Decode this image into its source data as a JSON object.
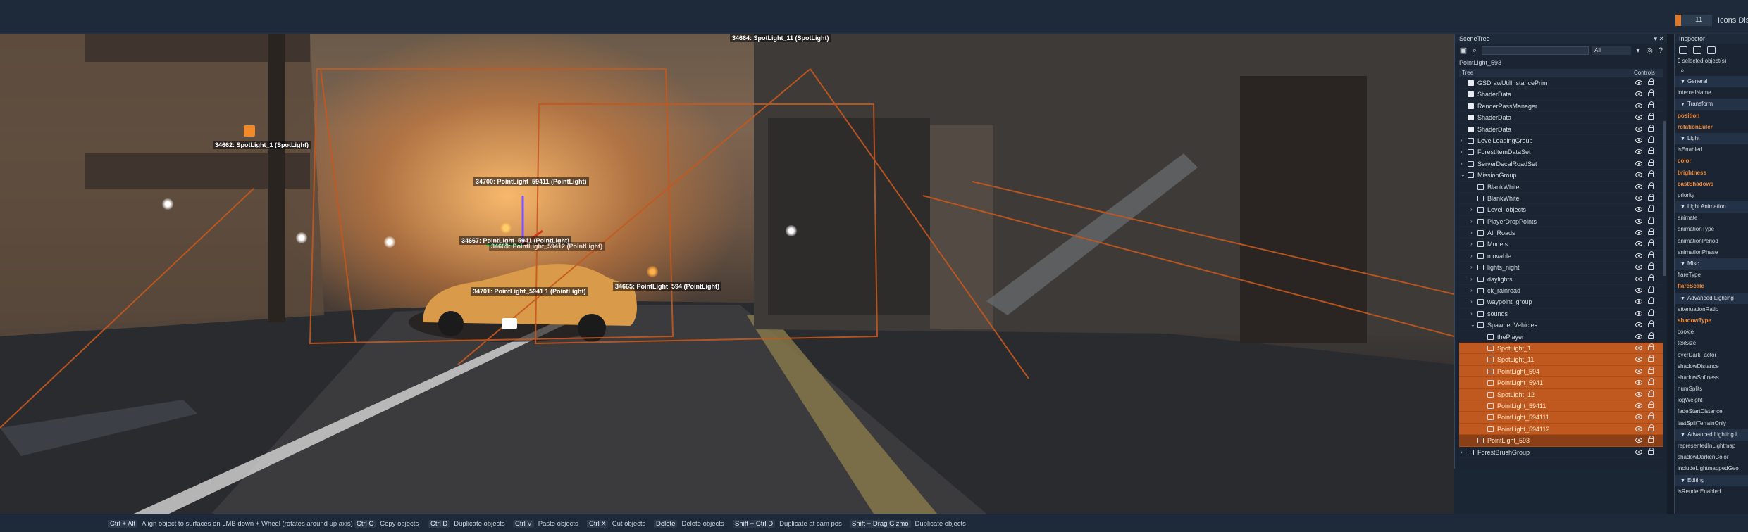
{
  "topbar": {
    "zoom_value": "11",
    "icons_label": "Icons Dista"
  },
  "viewport": {
    "labels": [
      "34664: SpotLight_11 (SpotLight)",
      "34662: SpotLight_1 (SpotLight)",
      "34700: PointLight_59411 (PointLight)",
      "34667: PointLight_5941 (PointLight)",
      "34669: PointLight_59412 (PointLight)",
      "34701: PointLight_5941 1 (PointLight)",
      "34665: PointLight_594 (PointLight)"
    ]
  },
  "scenetree": {
    "title": "SceneTree",
    "filter": "All",
    "path": "PointLight_593",
    "header_tree": "Tree",
    "header_controls": "Controls",
    "rows": [
      {
        "label": "GSDrawUtilInstancePrim",
        "indent": 0,
        "arrow": "",
        "icon": "fill",
        "sel": ""
      },
      {
        "label": "ShaderData",
        "indent": 0,
        "arrow": "",
        "icon": "fill",
        "sel": ""
      },
      {
        "label": "RenderPassManager",
        "indent": 0,
        "arrow": "",
        "icon": "fill",
        "sel": ""
      },
      {
        "label": "ShaderData",
        "indent": 0,
        "arrow": "",
        "icon": "fill",
        "sel": ""
      },
      {
        "label": "ShaderData",
        "indent": 0,
        "arrow": "",
        "icon": "fill",
        "sel": ""
      },
      {
        "label": "LevelLoadingGroup",
        "indent": 0,
        "arrow": "›",
        "icon": "folder",
        "sel": ""
      },
      {
        "label": "ForestItemDataSet",
        "indent": 0,
        "arrow": "›",
        "icon": "folder",
        "sel": ""
      },
      {
        "label": "ServerDecalRoadSet",
        "indent": 0,
        "arrow": "›",
        "icon": "folder",
        "sel": ""
      },
      {
        "label": "MissionGroup",
        "indent": 0,
        "arrow": "⌄",
        "icon": "folder",
        "sel": ""
      },
      {
        "label": "BlankWhite",
        "indent": 1,
        "arrow": "",
        "icon": "obj",
        "sel": ""
      },
      {
        "label": "BlankWhite",
        "indent": 1,
        "arrow": "",
        "icon": "obj",
        "sel": ""
      },
      {
        "label": "Level_objects",
        "indent": 1,
        "arrow": "›",
        "icon": "folder",
        "sel": ""
      },
      {
        "label": "PlayerDropPoints",
        "indent": 1,
        "arrow": "›",
        "icon": "folder",
        "sel": ""
      },
      {
        "label": "AI_Roads",
        "indent": 1,
        "arrow": "›",
        "icon": "folder",
        "sel": ""
      },
      {
        "label": "Models",
        "indent": 1,
        "arrow": "›",
        "icon": "folder",
        "sel": ""
      },
      {
        "label": "movable",
        "indent": 1,
        "arrow": "›",
        "icon": "folder",
        "sel": ""
      },
      {
        "label": "lights_night",
        "indent": 1,
        "arrow": "›",
        "icon": "folder",
        "sel": ""
      },
      {
        "label": "daylights",
        "indent": 1,
        "arrow": "›",
        "icon": "folder",
        "sel": ""
      },
      {
        "label": "ck_rainroad",
        "indent": 1,
        "arrow": "›",
        "icon": "folder",
        "sel": ""
      },
      {
        "label": "waypoint_group",
        "indent": 1,
        "arrow": "›",
        "icon": "folder",
        "sel": ""
      },
      {
        "label": "sounds",
        "indent": 1,
        "arrow": "›",
        "icon": "folder",
        "sel": ""
      },
      {
        "label": "SpawnedVehicles",
        "indent": 1,
        "arrow": "⌄",
        "icon": "folder",
        "sel": ""
      },
      {
        "label": "thePlayer",
        "indent": 2,
        "arrow": "",
        "icon": "obj",
        "sel": ""
      },
      {
        "label": "SpotLight_1",
        "indent": 2,
        "arrow": "",
        "icon": "obj",
        "sel": "sel"
      },
      {
        "label": "SpotLight_11",
        "indent": 2,
        "arrow": "",
        "icon": "obj",
        "sel": "sel"
      },
      {
        "label": "PointLight_594",
        "indent": 2,
        "arrow": "",
        "icon": "obj",
        "sel": "sel"
      },
      {
        "label": "PointLight_5941",
        "indent": 2,
        "arrow": "",
        "icon": "obj",
        "sel": "sel"
      },
      {
        "label": "SpotLight_12",
        "indent": 2,
        "arrow": "",
        "icon": "obj",
        "sel": "sel"
      },
      {
        "label": "PointLight_59411",
        "indent": 2,
        "arrow": "",
        "icon": "obj",
        "sel": "sel"
      },
      {
        "label": "PointLight_594111",
        "indent": 2,
        "arrow": "",
        "icon": "obj",
        "sel": "sel"
      },
      {
        "label": "PointLight_594112",
        "indent": 2,
        "arrow": "",
        "icon": "obj",
        "sel": "sel"
      },
      {
        "label": "PointLight_593",
        "indent": 1,
        "arrow": "",
        "icon": "obj",
        "sel": "sel dim"
      },
      {
        "label": "ForestBrushGroup",
        "indent": 0,
        "arrow": "›",
        "icon": "folder",
        "sel": ""
      }
    ]
  },
  "inspector": {
    "title": "Inspector",
    "selected_count": "9 selected object(s)",
    "rows": [
      {
        "label": "General",
        "type": "sec"
      },
      {
        "label": "internalName",
        "type": "prop"
      },
      {
        "label": "Transform",
        "type": "sec"
      },
      {
        "label": "position",
        "type": "hl"
      },
      {
        "label": "rotationEuler",
        "type": "hl"
      },
      {
        "label": "Light",
        "type": "sec"
      },
      {
        "label": "isEnabled",
        "type": "prop"
      },
      {
        "label": "color",
        "type": "hl"
      },
      {
        "label": "brightness",
        "type": "hl"
      },
      {
        "label": "castShadows",
        "type": "hl"
      },
      {
        "label": "priority",
        "type": "prop"
      },
      {
        "label": "Light Animation",
        "type": "sec"
      },
      {
        "label": "animate",
        "type": "prop"
      },
      {
        "label": "animationType",
        "type": "prop"
      },
      {
        "label": "animationPeriod",
        "type": "prop"
      },
      {
        "label": "animationPhase",
        "type": "prop"
      },
      {
        "label": "Misc",
        "type": "sec"
      },
      {
        "label": "flareType",
        "type": "prop"
      },
      {
        "label": "flareScale",
        "type": "hl"
      },
      {
        "label": "Advanced Lighting",
        "type": "sec"
      },
      {
        "label": "attenuationRatio",
        "type": "prop"
      },
      {
        "label": "shadowType",
        "type": "hl"
      },
      {
        "label": "cookie",
        "type": "prop"
      },
      {
        "label": "texSize",
        "type": "prop"
      },
      {
        "label": "overDarkFactor",
        "type": "prop"
      },
      {
        "label": "shadowDistance",
        "type": "prop"
      },
      {
        "label": "shadowSoftness",
        "type": "prop"
      },
      {
        "label": "numSplits",
        "type": "prop"
      },
      {
        "label": "logWeight",
        "type": "prop"
      },
      {
        "label": "fadeStartDistance",
        "type": "prop"
      },
      {
        "label": "lastSplitTerrainOnly",
        "type": "prop"
      },
      {
        "label": "Advanced Lighting L",
        "type": "sec"
      },
      {
        "label": "representedInLightmap",
        "type": "prop"
      },
      {
        "label": "shadowDarkenColor",
        "type": "prop"
      },
      {
        "label": "includeLightmappedGeo",
        "type": "prop"
      },
      {
        "label": "Editing",
        "type": "sec"
      },
      {
        "label": "isRenderEnabled",
        "type": "prop"
      }
    ]
  },
  "statusbar": {
    "hints": [
      {
        "key": "Ctrl + Alt",
        "desc": "Align object to surfaces on LMB down + Wheel (rotates around up axis)"
      },
      {
        "key": "Ctrl C",
        "desc": "Copy objects"
      },
      {
        "key": "Ctrl D",
        "desc": "Duplicate objects"
      },
      {
        "key": "Ctrl V",
        "desc": "Paste objects"
      },
      {
        "key": "Ctrl X",
        "desc": "Cut objects"
      },
      {
        "key": "Delete",
        "desc": "Delete objects"
      },
      {
        "key": "Shift + Ctrl D",
        "desc": "Duplicate at cam pos"
      },
      {
        "key": "Shift + Drag Gizmo",
        "desc": "Duplicate objects"
      }
    ]
  }
}
